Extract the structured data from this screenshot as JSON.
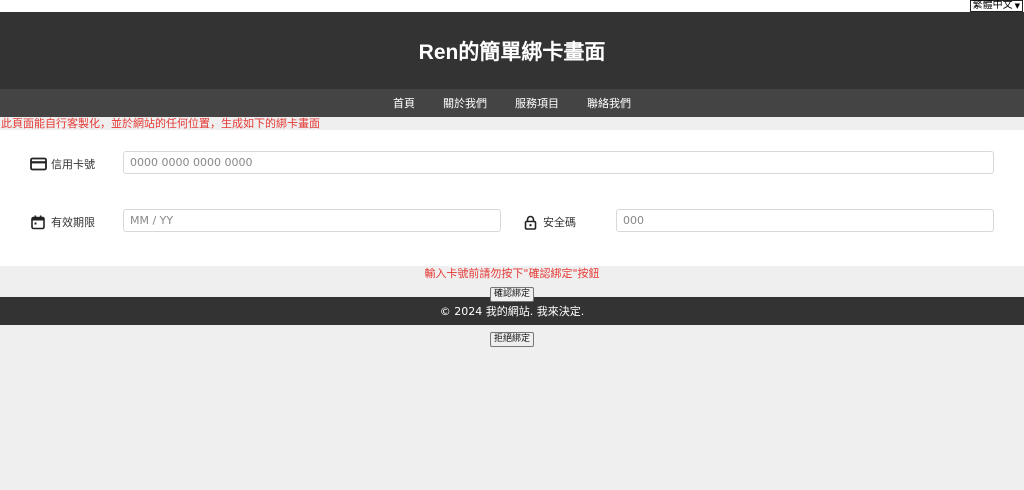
{
  "language_selector": {
    "value": "繁體中文"
  },
  "header": {
    "title": "Ren的簡單綁卡畫面"
  },
  "nav": {
    "items": [
      {
        "label": "首頁"
      },
      {
        "label": "關於我們"
      },
      {
        "label": "服務項目"
      },
      {
        "label": "聯絡我們"
      }
    ]
  },
  "notice_top": "此頁面能自行客製化，並於網站的任何位置，生成如下的綁卡畫面",
  "form": {
    "card_number": {
      "label": "信用卡號",
      "placeholder": "0000 0000 0000 0000",
      "icon": "credit-card-icon"
    },
    "expiry": {
      "label": "有效期限",
      "placeholder": "MM / YY",
      "icon": "calendar-icon"
    },
    "cvc": {
      "label": "安全碼",
      "placeholder": "000",
      "icon": "lock-icon"
    }
  },
  "notice_bottom": "輸入卡號前請勿按下\"確認綁定\"按鈕",
  "confirm_button": "確認綁定",
  "footer": {
    "text": "© 2024 我的網站. 我來決定."
  },
  "reject_button": "拒絕綁定",
  "colors": {
    "header_bg": "#333333",
    "nav_bg": "#444444",
    "notice": "#e53935",
    "page_bg": "#efefef"
  }
}
